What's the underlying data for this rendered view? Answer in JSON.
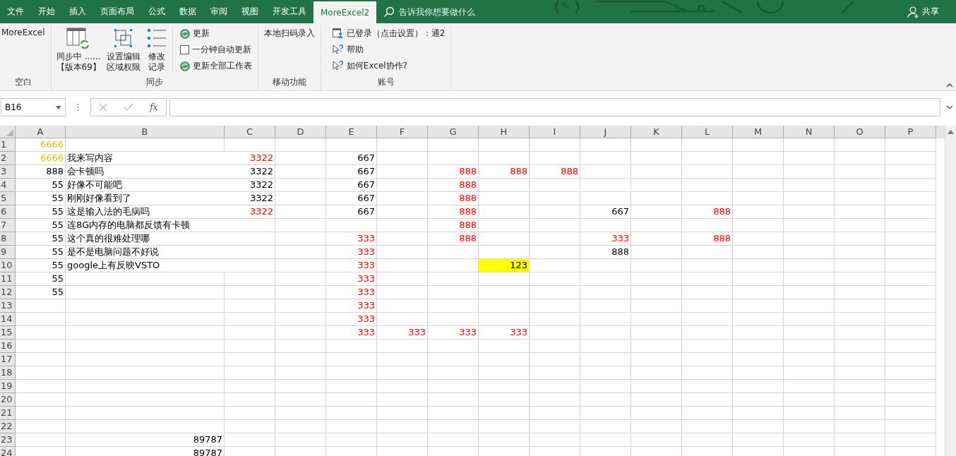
{
  "tabs": [
    {
      "label": "文件",
      "selected": false
    },
    {
      "label": "开始",
      "selected": false
    },
    {
      "label": "插入",
      "selected": false
    },
    {
      "label": "页面布局",
      "selected": false
    },
    {
      "label": "公式",
      "selected": false
    },
    {
      "label": "数据",
      "selected": false
    },
    {
      "label": "审阅",
      "selected": false
    },
    {
      "label": "视图",
      "selected": false
    },
    {
      "label": "开发工具",
      "selected": false
    },
    {
      "label": "MoreExcel2",
      "selected": true
    }
  ],
  "search": {
    "placeholder": "告诉我你想要做什么"
  },
  "share": {
    "label": "共享"
  },
  "ribbon": {
    "groups": [
      {
        "label": "空白",
        "items": [
          {
            "kind": "text",
            "label": "MoreExcel"
          }
        ]
      },
      {
        "label": "同步",
        "items": [
          {
            "kind": "large",
            "lines": [
              "同步中 ......",
              "【版本69】"
            ]
          },
          {
            "kind": "large",
            "lines": [
              "设置编辑",
              "区域权限"
            ]
          },
          {
            "kind": "large",
            "lines": [
              "修改",
              "记录"
            ]
          },
          {
            "kind": "stack",
            "items": [
              {
                "kind": "refresh",
                "label": "更新"
              },
              {
                "kind": "checkbox",
                "label": "一分钟自动更新",
                "checked": false
              },
              {
                "kind": "refresh",
                "label": "更新全部工作表"
              }
            ]
          }
        ]
      },
      {
        "label": "移动功能",
        "items": [
          {
            "kind": "text",
            "label": "本地扫码录入"
          }
        ]
      },
      {
        "label": "账号",
        "items": [
          {
            "kind": "stack",
            "items": [
              {
                "kind": "user",
                "label": "已登录（点击设置）：通2"
              },
              {
                "kind": "help",
                "label": "帮助"
              },
              {
                "kind": "help",
                "label": "如何Excel协作?"
              }
            ]
          }
        ]
      }
    ]
  },
  "formula_bar": {
    "name_box": "B16",
    "fx": "fx"
  },
  "sheet": {
    "columns": [
      "A",
      "B",
      "C",
      "D",
      "E",
      "F",
      "G",
      "H",
      "I",
      "J",
      "K",
      "L",
      "M",
      "N",
      "O",
      "P"
    ],
    "rows": [
      {
        "header": "1",
        "cells": {
          "A": {
            "text": "6666",
            "kind": "number",
            "color": "#e0c000"
          }
        }
      },
      {
        "header": "2",
        "cells": {
          "A": {
            "text": "6666",
            "kind": "number",
            "color": "#e0c000"
          },
          "B": {
            "text": "我来写内容",
            "kind": "text"
          },
          "C": {
            "text": "3322",
            "kind": "number",
            "color": "#ff0000"
          },
          "E": {
            "text": "667",
            "kind": "number"
          }
        }
      },
      {
        "header": "3",
        "cells": {
          "A": {
            "text": "888",
            "kind": "number"
          },
          "B": {
            "text": "会卡顿吗",
            "kind": "text"
          },
          "C": {
            "text": "3322",
            "kind": "number"
          },
          "E": {
            "text": "667",
            "kind": "number"
          },
          "G": {
            "text": "888",
            "kind": "number",
            "color": "#ff0000"
          },
          "H": {
            "text": "888",
            "kind": "number",
            "color": "#ff0000"
          },
          "I": {
            "text": "888",
            "kind": "number",
            "color": "#ff0000"
          }
        }
      },
      {
        "header": "4",
        "cells": {
          "A": {
            "text": "55",
            "kind": "number"
          },
          "B": {
            "text": "好像不可能吧",
            "kind": "text"
          },
          "C": {
            "text": "3322",
            "kind": "number"
          },
          "E": {
            "text": "667",
            "kind": "number"
          },
          "G": {
            "text": "888",
            "kind": "number",
            "color": "#ff0000"
          }
        }
      },
      {
        "header": "5",
        "cells": {
          "A": {
            "text": "55",
            "kind": "number"
          },
          "B": {
            "text": "刚刚好像看到了",
            "kind": "text"
          },
          "C": {
            "text": "3322",
            "kind": "number"
          },
          "E": {
            "text": "667",
            "kind": "number"
          },
          "G": {
            "text": "888",
            "kind": "number",
            "color": "#ff0000"
          }
        }
      },
      {
        "header": "6",
        "cells": {
          "A": {
            "text": "55",
            "kind": "number"
          },
          "B": {
            "text": "这是输入法的毛病吗",
            "kind": "text"
          },
          "C": {
            "text": "3322",
            "kind": "number",
            "color": "#ff0000"
          },
          "E": {
            "text": "667",
            "kind": "number"
          },
          "G": {
            "text": "888",
            "kind": "number",
            "color": "#ff0000"
          },
          "J": {
            "text": "667",
            "kind": "number"
          },
          "L": {
            "text": "888",
            "kind": "number",
            "color": "#ff0000"
          }
        }
      },
      {
        "header": "7",
        "cells": {
          "A": {
            "text": "55",
            "kind": "number"
          },
          "B": {
            "text": "连8G内存的电脑都反馈有卡顿",
            "kind": "text"
          },
          "G": {
            "text": "888",
            "kind": "number",
            "color": "#ff0000"
          }
        }
      },
      {
        "header": "8",
        "cells": {
          "A": {
            "text": "55",
            "kind": "number"
          },
          "B": {
            "text": "这个真的很难处理哪",
            "kind": "text"
          },
          "E": {
            "text": "333",
            "kind": "number",
            "color": "#ff0000"
          },
          "G": {
            "text": "888",
            "kind": "number",
            "color": "#ff0000"
          },
          "J": {
            "text": "333",
            "kind": "number",
            "color": "#ff0000"
          },
          "L": {
            "text": "888",
            "kind": "number",
            "color": "#ff0000"
          }
        }
      },
      {
        "header": "9",
        "cells": {
          "A": {
            "text": "55",
            "kind": "number"
          },
          "B": {
            "text": "是不是电脑问题不好说",
            "kind": "text"
          },
          "E": {
            "text": "333",
            "kind": "number",
            "color": "#ff0000"
          },
          "J": {
            "text": "888",
            "kind": "number"
          }
        }
      },
      {
        "header": "10",
        "cells": {
          "A": {
            "text": "55",
            "kind": "number"
          },
          "B": {
            "text": "google上有反映VSTO",
            "kind": "text"
          },
          "E": {
            "text": "333",
            "kind": "number",
            "color": "#ff0000"
          },
          "H": {
            "text": "123",
            "kind": "number",
            "highlighted": true
          }
        }
      },
      {
        "header": "11",
        "cells": {
          "A": {
            "text": "55",
            "kind": "number"
          },
          "E": {
            "text": "333",
            "kind": "number",
            "color": "#ff0000"
          }
        }
      },
      {
        "header": "12",
        "cells": {
          "A": {
            "text": "55",
            "kind": "number"
          },
          "E": {
            "text": "333",
            "kind": "number",
            "color": "#ff0000"
          }
        }
      },
      {
        "header": "13",
        "cells": {
          "E": {
            "text": "333",
            "kind": "number",
            "color": "#ff0000"
          }
        }
      },
      {
        "header": "14",
        "cells": {
          "E": {
            "text": "333",
            "kind": "number",
            "color": "#ff0000"
          }
        }
      },
      {
        "header": "15",
        "cells": {
          "E": {
            "text": "333",
            "kind": "number",
            "color": "#ff0000"
          },
          "F": {
            "text": "333",
            "kind": "number",
            "color": "#ff0000"
          },
          "G": {
            "text": "333",
            "kind": "number",
            "color": "#ff0000"
          },
          "H": {
            "text": "333",
            "kind": "number",
            "color": "#ff0000"
          }
        }
      },
      {
        "header": "16",
        "cells": {}
      },
      {
        "header": "17",
        "cells": {}
      },
      {
        "header": "18",
        "cells": {}
      },
      {
        "header": "19",
        "cells": {}
      },
      {
        "header": "20",
        "cells": {}
      },
      {
        "header": "21",
        "cells": {}
      },
      {
        "header": "22",
        "cells": {}
      },
      {
        "header": "23",
        "cells": {
          "B": {
            "text": "89787",
            "kind": "number"
          }
        }
      },
      {
        "header": "24",
        "cells": {
          "B": {
            "text": "89787",
            "kind": "number"
          }
        }
      }
    ]
  }
}
